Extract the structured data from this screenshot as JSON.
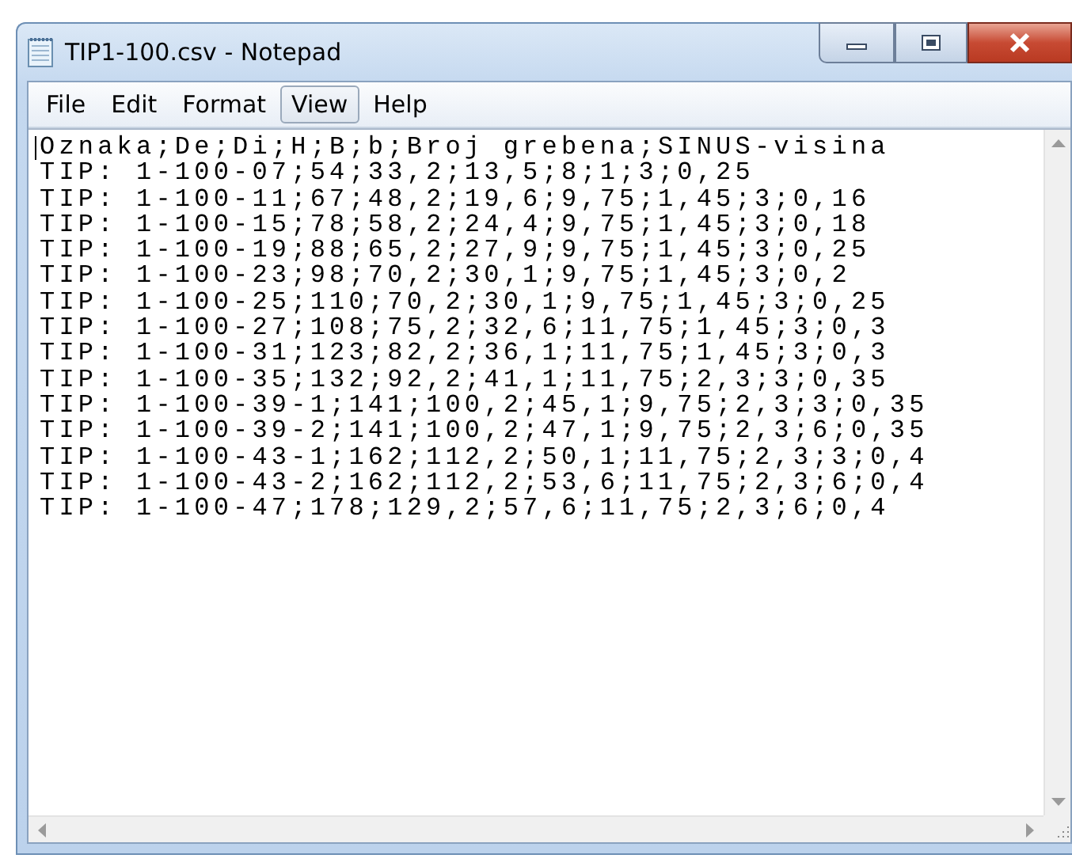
{
  "window": {
    "title": "TIP1-100.csv - Notepad"
  },
  "menu": [
    {
      "label": "File",
      "selected": false
    },
    {
      "label": "Edit",
      "selected": false
    },
    {
      "label": "Format",
      "selected": false
    },
    {
      "label": "View",
      "selected": true
    },
    {
      "label": "Help",
      "selected": false
    }
  ],
  "lines": [
    "Oznaka;De;Di;H;B;b;Broj grebena;SINUS-visina",
    "TIP: 1-100-07;54;33,2;13,5;8;1;3;0,25",
    "TIP: 1-100-11;67;48,2;19,6;9,75;1,45;3;0,16",
    "TIP: 1-100-15;78;58,2;24,4;9,75;1,45;3;0,18",
    "TIP: 1-100-19;88;65,2;27,9;9,75;1,45;3;0,25",
    "TIP: 1-100-23;98;70,2;30,1;9,75;1,45;3;0,2",
    "TIP: 1-100-25;110;70,2;30,1;9,75;1,45;3;0,25",
    "TIP: 1-100-27;108;75,2;32,6;11,75;1,45;3;0,3",
    "TIP: 1-100-31;123;82,2;36,1;11,75;1,45;3;0,3",
    "TIP: 1-100-35;132;92,2;41,1;11,75;2,3;3;0,35",
    "TIP: 1-100-39-1;141;100,2;45,1;9,75;2,3;3;0,35",
    "TIP: 1-100-39-2;141;100,2;47,1;9,75;2,3;6;0,35",
    "TIP: 1-100-43-1;162;112,2;50,1;11,75;2,3;3;0,4",
    "TIP: 1-100-43-2;162;112,2;53,6;11,75;2,3;6;0,4",
    "TIP: 1-100-47;178;129,2;57,6;11,75;2,3;6;0,4"
  ]
}
